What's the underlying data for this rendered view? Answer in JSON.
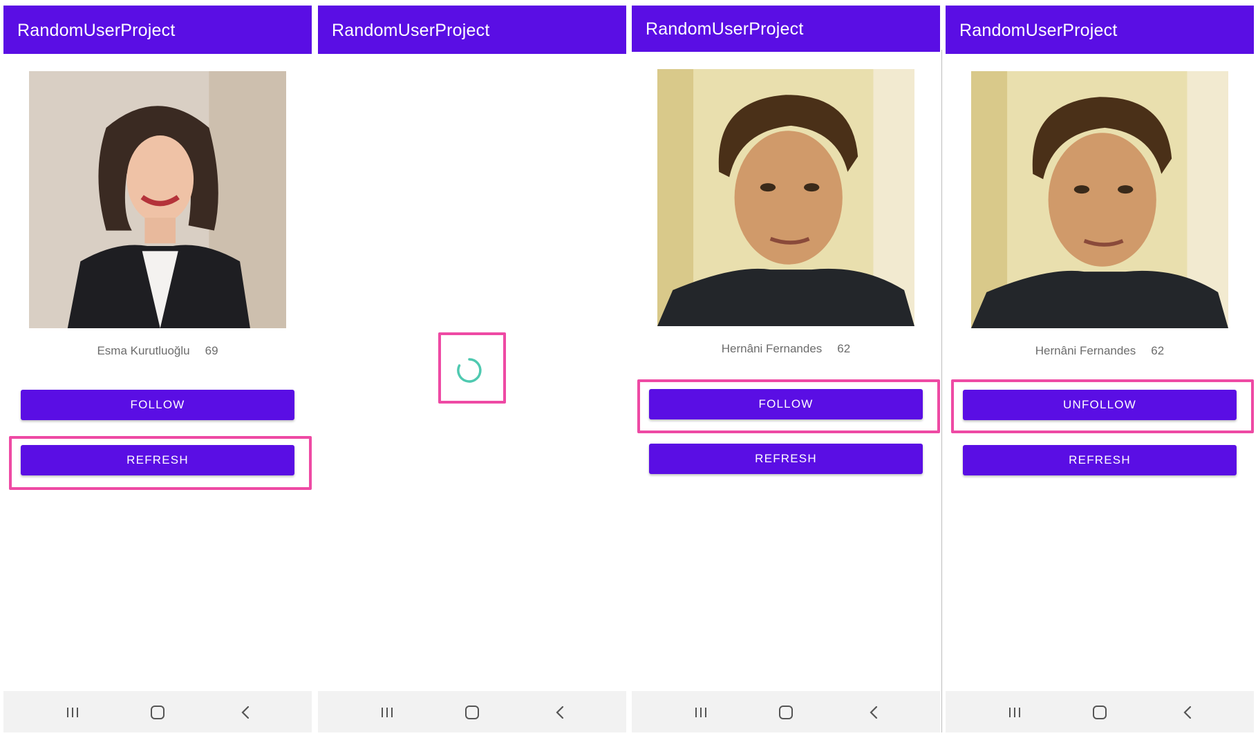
{
  "app_title": "RandomUserProject",
  "panels": [
    {
      "state": "loaded",
      "user": {
        "name": "Esma Kurutluoğlu",
        "age": "69"
      },
      "follow_label": "FOLLOW",
      "refresh_label": "REFRESH",
      "highlighted": "refresh-button"
    },
    {
      "state": "loading",
      "highlighted": "loading-spinner"
    },
    {
      "state": "loaded",
      "user": {
        "name": "Hernâni Fernandes",
        "age": "62"
      },
      "follow_label": "FOLLOW",
      "refresh_label": "REFRESH",
      "highlighted": "follow-button"
    },
    {
      "state": "loaded",
      "user": {
        "name": "Hernâni Fernandes",
        "age": "62"
      },
      "follow_label": "UNFOLLOW",
      "refresh_label": "REFRESH",
      "highlighted": "unfollow-button"
    }
  ],
  "colors": {
    "primary": "#5a0ee4",
    "highlight": "#ee4aa4",
    "spinner": "#4fc9b0",
    "nav_bar": "#f2f2f2",
    "secondary_text": "#6c6c6c"
  },
  "icons": {
    "nav": [
      "recents-icon",
      "home-icon",
      "back-icon"
    ],
    "spinner": "loading-spinner-icon"
  }
}
